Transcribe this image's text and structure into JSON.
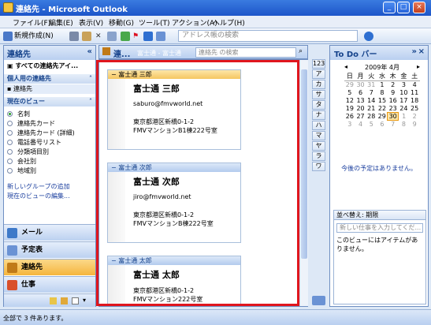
{
  "window": {
    "title": "連絡先 - Microsoft Outlook"
  },
  "menu": [
    "ファイル(F)",
    "編集(E)",
    "表示(V)",
    "移動(G)",
    "ツール(T)",
    "アクション(A)",
    "ヘルプ(H)"
  ],
  "toolbar": {
    "new_label": "新規作成(N)",
    "address_search_placeholder": "アドレス帳の検索"
  },
  "nav": {
    "header": "連絡先",
    "all_contacts": "すべての連絡先アイ...",
    "personal_section": "個人用の連絡先",
    "contacts_item": "連絡先",
    "current_view_section": "現在のビュー",
    "views": [
      "名刺",
      "連絡先カード",
      "連絡先カード (詳細)",
      "電話番号リスト",
      "分類項目別",
      "会社別",
      "地域別"
    ],
    "selected_view_index": 0,
    "link_add_group": "新しいグループの追加",
    "link_edit_view": "現在のビューの編集..."
  },
  "nav_buttons": [
    {
      "label": "メール"
    },
    {
      "label": "予定表"
    },
    {
      "label": "連絡先",
      "selected": true
    },
    {
      "label": "仕事"
    }
  ],
  "content_header": {
    "title": "連...",
    "subtitle": "富士通 - 富士通",
    "search_placeholder": "連絡先 の検索"
  },
  "cards": [
    {
      "header": "富士通 三郎",
      "name": "富士通 三郎",
      "email": "saburo@fmvworld.net",
      "address1": "東京都港区新橋0-1-2",
      "address2": "FMVマンションB1棟222号室",
      "selected": true
    },
    {
      "header": "富士通 次郎",
      "name": "富士通 次郎",
      "email": "jiro@fmvworld.net",
      "address1": "東京都港区新橋0-1-2",
      "address2": "FMVマンションB棟222号室",
      "selected": false
    },
    {
      "header": "富士通 太郎",
      "name": "富士通 太郎",
      "email": "",
      "address1": "東京都港区新橋0-1-2",
      "address2": "FMVマンション222号室",
      "selected": false
    }
  ],
  "index_tabs": [
    "123",
    "ア",
    "カ",
    "サ",
    "タ",
    "ナ",
    "ハ",
    "マ",
    "ヤ",
    "ラ",
    "ワ"
  ],
  "todo": {
    "header": "To Do バー",
    "month": "2009年 4月",
    "weekdays": [
      "日",
      "月",
      "火",
      "水",
      "木",
      "金",
      "土"
    ],
    "weeks": [
      [
        {
          "d": "29",
          "dim": true
        },
        {
          "d": "30",
          "dim": true
        },
        {
          "d": "31",
          "dim": true
        },
        {
          "d": "1"
        },
        {
          "d": "2"
        },
        {
          "d": "3"
        },
        {
          "d": "4"
        }
      ],
      [
        {
          "d": "5"
        },
        {
          "d": "6"
        },
        {
          "d": "7"
        },
        {
          "d": "8"
        },
        {
          "d": "9"
        },
        {
          "d": "10"
        },
        {
          "d": "11"
        }
      ],
      [
        {
          "d": "12"
        },
        {
          "d": "13"
        },
        {
          "d": "14"
        },
        {
          "d": "15"
        },
        {
          "d": "16"
        },
        {
          "d": "17"
        },
        {
          "d": "18"
        }
      ],
      [
        {
          "d": "19"
        },
        {
          "d": "20"
        },
        {
          "d": "21"
        },
        {
          "d": "22"
        },
        {
          "d": "23"
        },
        {
          "d": "24"
        },
        {
          "d": "25"
        }
      ],
      [
        {
          "d": "26"
        },
        {
          "d": "27"
        },
        {
          "d": "28"
        },
        {
          "d": "29"
        },
        {
          "d": "30",
          "today": true
        },
        {
          "d": "1",
          "dim": true
        },
        {
          "d": "2",
          "dim": true
        }
      ],
      [
        {
          "d": "3",
          "dim": true
        },
        {
          "d": "4",
          "dim": true
        },
        {
          "d": "5",
          "dim": true
        },
        {
          "d": "6",
          "dim": true
        },
        {
          "d": "7",
          "dim": true
        },
        {
          "d": "8",
          "dim": true
        },
        {
          "d": "9",
          "dim": true
        }
      ]
    ],
    "no_appointments": "今後の予定はありません。",
    "task_sort_label": "並べ替え: 期限",
    "task_input_placeholder": "新しい仕事を入力してくだ...",
    "task_empty_message": "このビューにはアイテムがありません。"
  },
  "status": {
    "text": "全部で 3 件あります。"
  },
  "colors": {
    "highlight_border": "#e0161e",
    "selected_nav": "#f5b53d"
  }
}
